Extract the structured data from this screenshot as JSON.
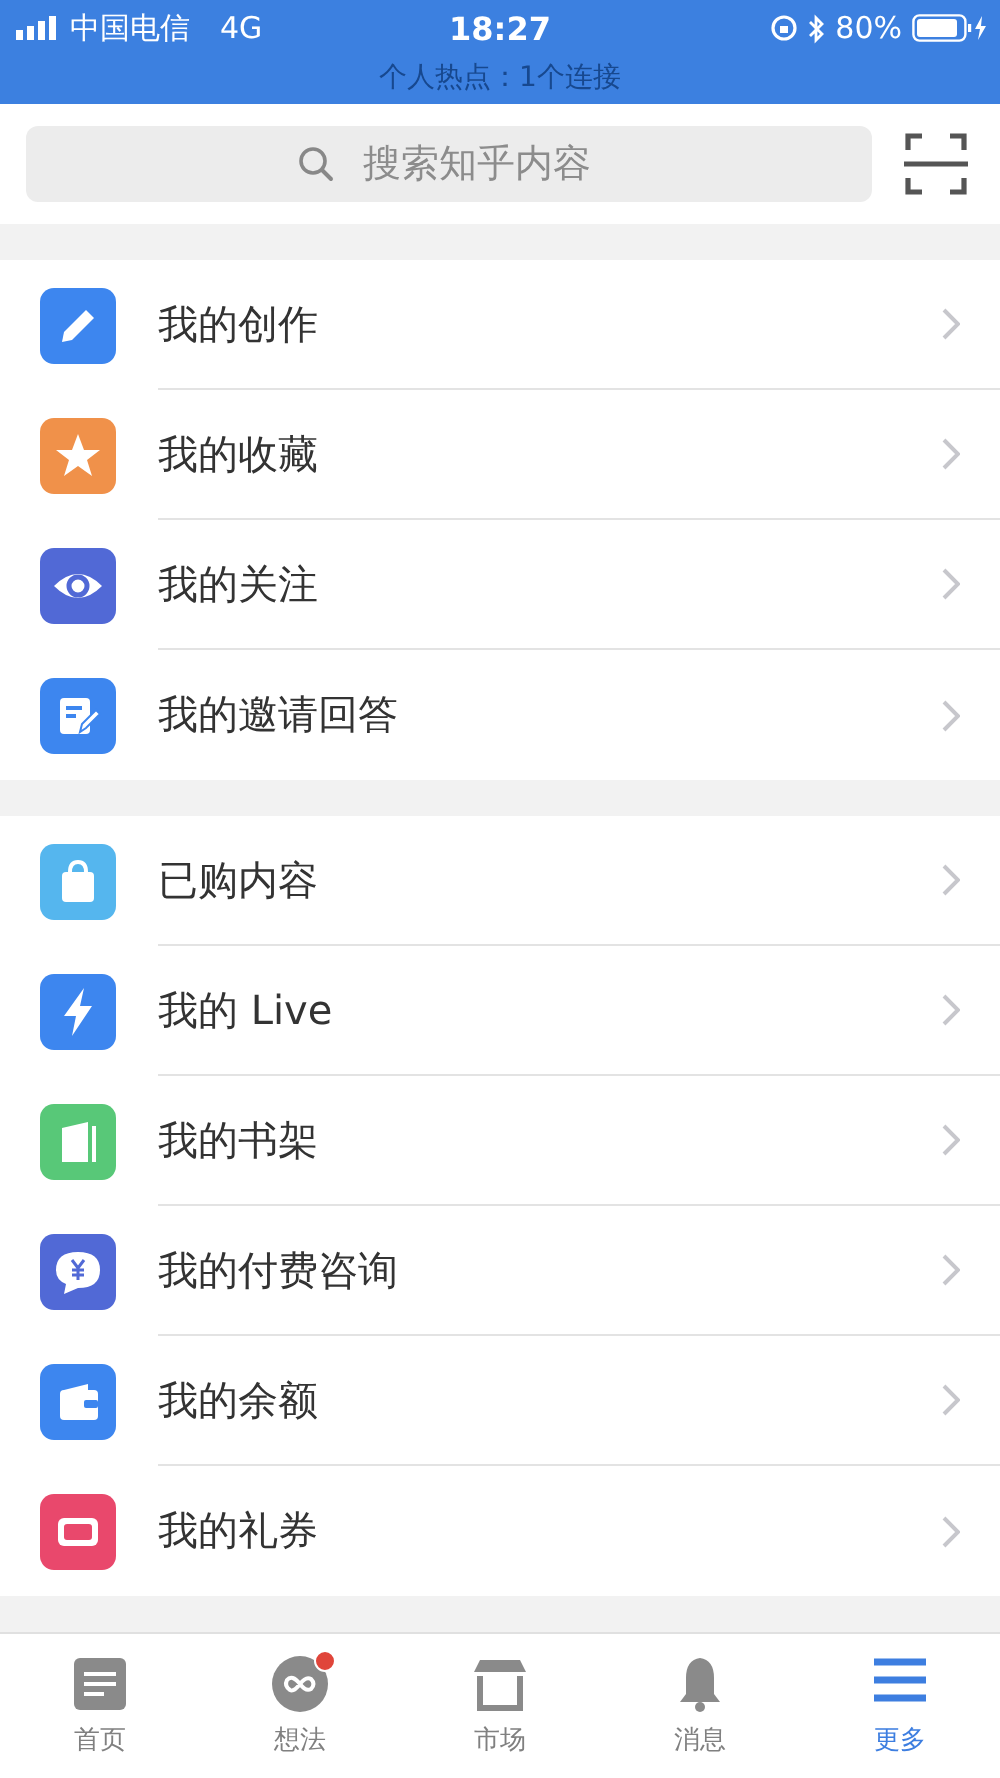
{
  "status_bar": {
    "carrier": "中国电信",
    "network": "4G",
    "time": "18:27",
    "battery": "80%",
    "hotspot_banner": "个人热点：1个连接"
  },
  "search": {
    "placeholder": "搜索知乎内容"
  },
  "groups": [
    {
      "items": [
        {
          "label": "我的创作",
          "color": "#3d86ef"
        },
        {
          "label": "我的收藏",
          "color": "#f0914a"
        },
        {
          "label": "我的关注",
          "color": "#5169d6"
        },
        {
          "label": "我的邀请回答",
          "color": "#3d86ef"
        }
      ]
    },
    {
      "items": [
        {
          "label": "已购内容",
          "color": "#55b6ee"
        },
        {
          "label": "我的 Live",
          "color": "#3d86ef"
        },
        {
          "label": "我的书架",
          "color": "#58c878"
        },
        {
          "label": "我的付费咨询",
          "color": "#5169d6"
        },
        {
          "label": "我的余额",
          "color": "#3d86ef"
        },
        {
          "label": "我的礼券",
          "color": "#e9486c"
        }
      ]
    }
  ],
  "tab_bar": [
    {
      "label": "首页",
      "selected": false,
      "dot": false
    },
    {
      "label": "想法",
      "selected": false,
      "dot": true
    },
    {
      "label": "市场",
      "selected": false,
      "dot": false
    },
    {
      "label": "消息",
      "selected": false,
      "dot": false
    },
    {
      "label": "更多",
      "selected": true,
      "dot": false
    }
  ]
}
